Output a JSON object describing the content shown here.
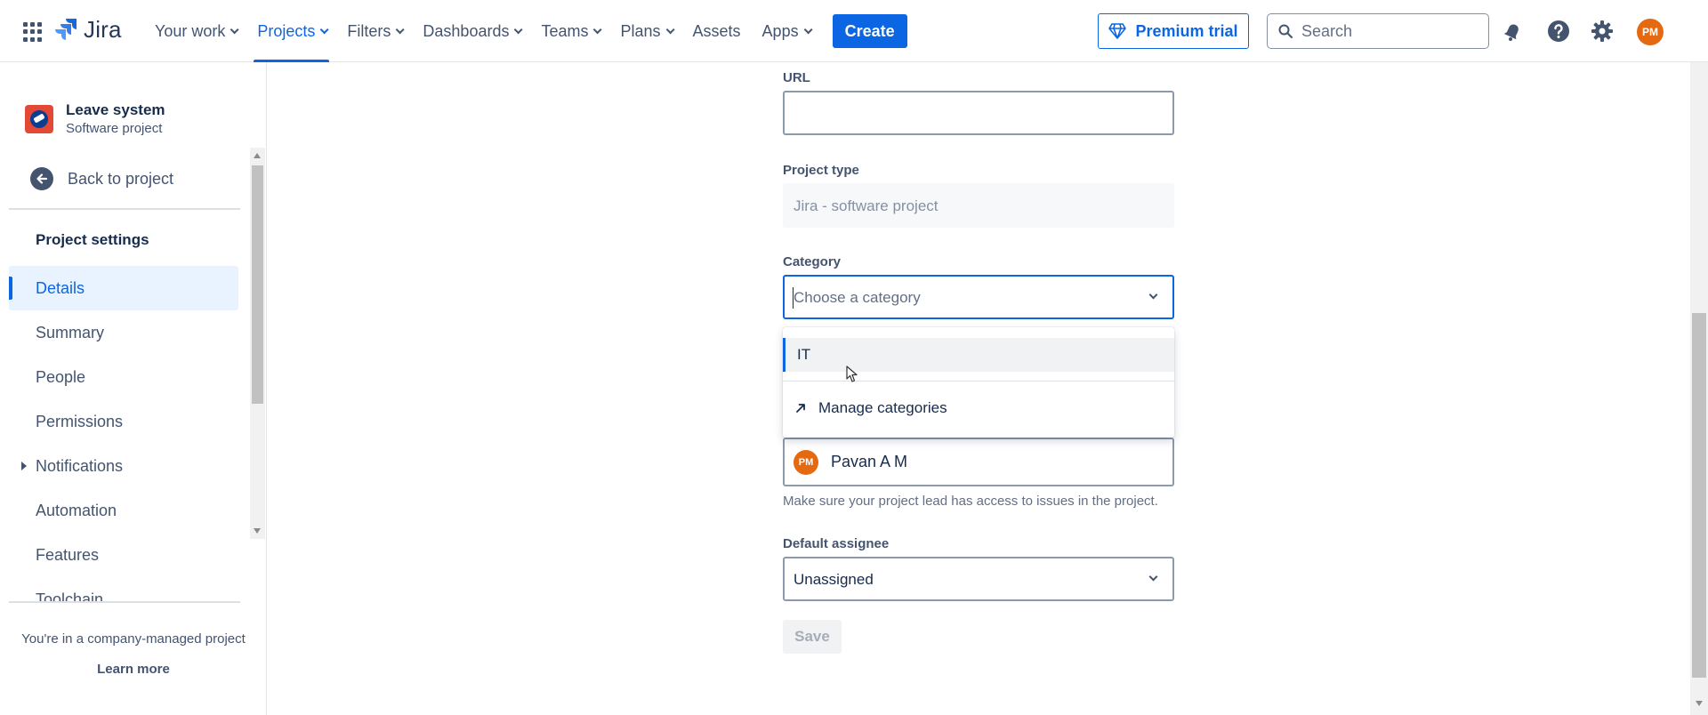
{
  "topnav": {
    "logo_text": "Jira",
    "items": [
      {
        "label": "Your work",
        "chevron": true,
        "active": false
      },
      {
        "label": "Projects",
        "chevron": true,
        "active": true
      },
      {
        "label": "Filters",
        "chevron": true,
        "active": false
      },
      {
        "label": "Dashboards",
        "chevron": true,
        "active": false
      },
      {
        "label": "Teams",
        "chevron": true,
        "active": false
      },
      {
        "label": "Plans",
        "chevron": true,
        "active": false
      },
      {
        "label": "Assets",
        "chevron": false,
        "active": false
      },
      {
        "label": "Apps",
        "chevron": true,
        "active": false
      }
    ],
    "create_label": "Create",
    "premium_label": "Premium trial",
    "search_placeholder": "Search",
    "avatar_initials": "PM"
  },
  "sidebar": {
    "project_name": "Leave system",
    "project_type": "Software project",
    "back_label": "Back to project",
    "section_title": "Project settings",
    "items": [
      {
        "label": "Details",
        "selected": true,
        "expandable": false
      },
      {
        "label": "Summary",
        "selected": false,
        "expandable": false
      },
      {
        "label": "People",
        "selected": false,
        "expandable": false
      },
      {
        "label": "Permissions",
        "selected": false,
        "expandable": false
      },
      {
        "label": "Notifications",
        "selected": false,
        "expandable": true
      },
      {
        "label": "Automation",
        "selected": false,
        "expandable": false
      },
      {
        "label": "Features",
        "selected": false,
        "expandable": false
      },
      {
        "label": "Toolchain",
        "selected": false,
        "expandable": false
      }
    ],
    "company_note": "You're in a company-managed project",
    "learn_more": "Learn more"
  },
  "form": {
    "url_label": "URL",
    "url_value": "",
    "project_type_label": "Project type",
    "project_type_value": "Jira - software project",
    "category_label": "Category",
    "category_placeholder": "Choose a category",
    "category_options": [
      "IT"
    ],
    "manage_categories": "Manage categories",
    "lead_initials": "PM",
    "lead_name": "Pavan A M",
    "lead_helper": "Make sure your project lead has access to issues in the project.",
    "default_assignee_label": "Default assignee",
    "default_assignee_value": "Unassigned",
    "save_label": "Save"
  },
  "colors": {
    "accent": "#0c66e4",
    "avatar": "#e56910"
  }
}
